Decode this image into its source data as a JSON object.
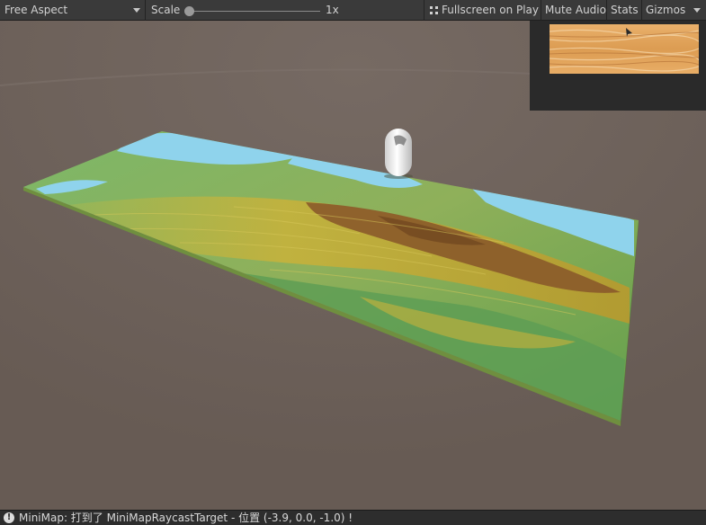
{
  "toolbar": {
    "aspect_label": "Free Aspect",
    "scale_label": "Scale",
    "scale_value": "1x",
    "scale_level": 0.0,
    "fullscreen_label": "Fullscreen on Play",
    "mute_label": "Mute Audio",
    "stats_label": "Stats",
    "gizmos_label": "Gizmos"
  },
  "status": {
    "message": "MiniMap: 打到了 MiniMapRaycastTarget  -  位置 (-3.9, 0.0, -1.0) !"
  },
  "colors": {
    "background": "#6a5e57",
    "toolbar": "#3a3a3a",
    "statusbar": "#2d2d2d",
    "map_water": "#8fd3ec",
    "map_lowland": "#6aa84f",
    "map_highland": "#c9b23a",
    "map_mountain": "#8a5a2a",
    "minimap_wood": "#e3a45a"
  },
  "icons": [
    "fullscreen-icon",
    "dropdown-arrow-icon",
    "warning-icon",
    "player-arrow-icon"
  ]
}
